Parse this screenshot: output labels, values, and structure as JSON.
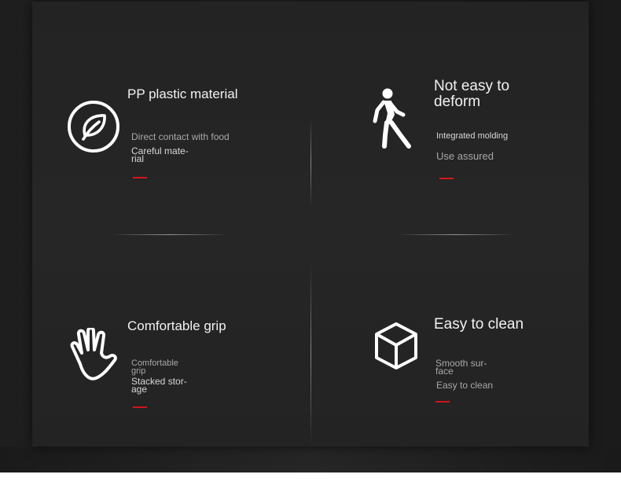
{
  "colors": {
    "background": "#232323",
    "title": "#f2f2f2",
    "subtitle": "#a8a8a8",
    "accent": "#d0161b"
  },
  "features": [
    {
      "icon": "leaf-circle-icon",
      "title": "PP plastic material",
      "line1": "Direct contact with food",
      "line2": "Careful mate-rial"
    },
    {
      "icon": "walking-person-icon",
      "title": "Not easy to deform",
      "line1": "Integrated molding",
      "line2": "Use assured"
    },
    {
      "icon": "hand-icon",
      "title": "Comfortable grip",
      "line1": "Comfortable grip",
      "line2": "Stacked stor-age"
    },
    {
      "icon": "cube-icon",
      "title": "Easy to clean",
      "line1": "Smooth sur-face",
      "line2": "Easy to clean"
    }
  ]
}
